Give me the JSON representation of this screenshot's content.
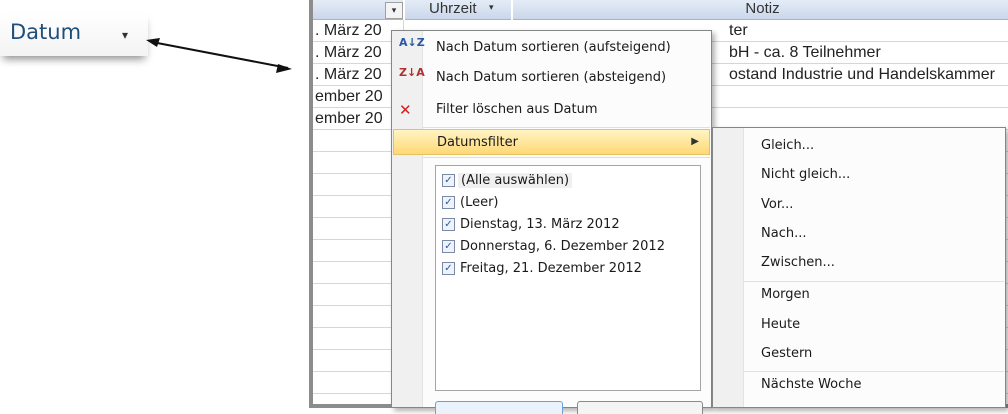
{
  "header_chip": {
    "label": "Datum",
    "dropdown_glyph": "▾"
  },
  "sheet": {
    "headers": {
      "uhrzeit": "Uhrzeit",
      "notiz": "Notiz",
      "dropdown_glyph": "▾"
    },
    "rows": [
      {
        "datum": ". März 20",
        "notiz": "ter"
      },
      {
        "datum": ". März 20",
        "notiz": "bH - ca. 8 Teilnehmer"
      },
      {
        "datum": ". März 20",
        "notiz": "ostand Industrie und Handelskammer"
      },
      {
        "datum": "ember 20",
        "notiz": ""
      },
      {
        "datum": "ember 20",
        "notiz": ""
      }
    ]
  },
  "menu": {
    "items": [
      {
        "label": "Nach Datum sortieren (aufsteigend)",
        "icon": "sort-ascending-icon",
        "icon_text": "A↓Z"
      },
      {
        "label": "Nach Datum sortieren (absteigend)",
        "icon": "sort-descending-icon",
        "icon_text": "Z↓A"
      },
      {
        "label": "Filter löschen aus Datum",
        "icon": "clear-filter-icon",
        "icon_text": "✕"
      },
      {
        "label": "Datumsfilter",
        "icon": "",
        "submenu_glyph": "▶"
      }
    ],
    "checklist": [
      {
        "label": "(Alle auswählen)",
        "checked": true
      },
      {
        "label": "(Leer)",
        "checked": true
      },
      {
        "label": "Dienstag, 13. März 2012",
        "checked": true
      },
      {
        "label": "Donnerstag, 6. Dezember 2012",
        "checked": true
      },
      {
        "label": "Freitag, 21. Dezember 2012",
        "checked": true
      }
    ],
    "check_glyph": "✓"
  },
  "submenu": {
    "items": [
      "Gleich...",
      "Nicht gleich...",
      "Vor...",
      "Nach...",
      "Zwischen...",
      "Morgen",
      "Heute",
      "Gestern",
      "Nächste Woche"
    ]
  },
  "colors": {
    "highlight_top": "#fff4c4",
    "highlight_bottom": "#ffd876",
    "header_text": "#1f4e79"
  }
}
